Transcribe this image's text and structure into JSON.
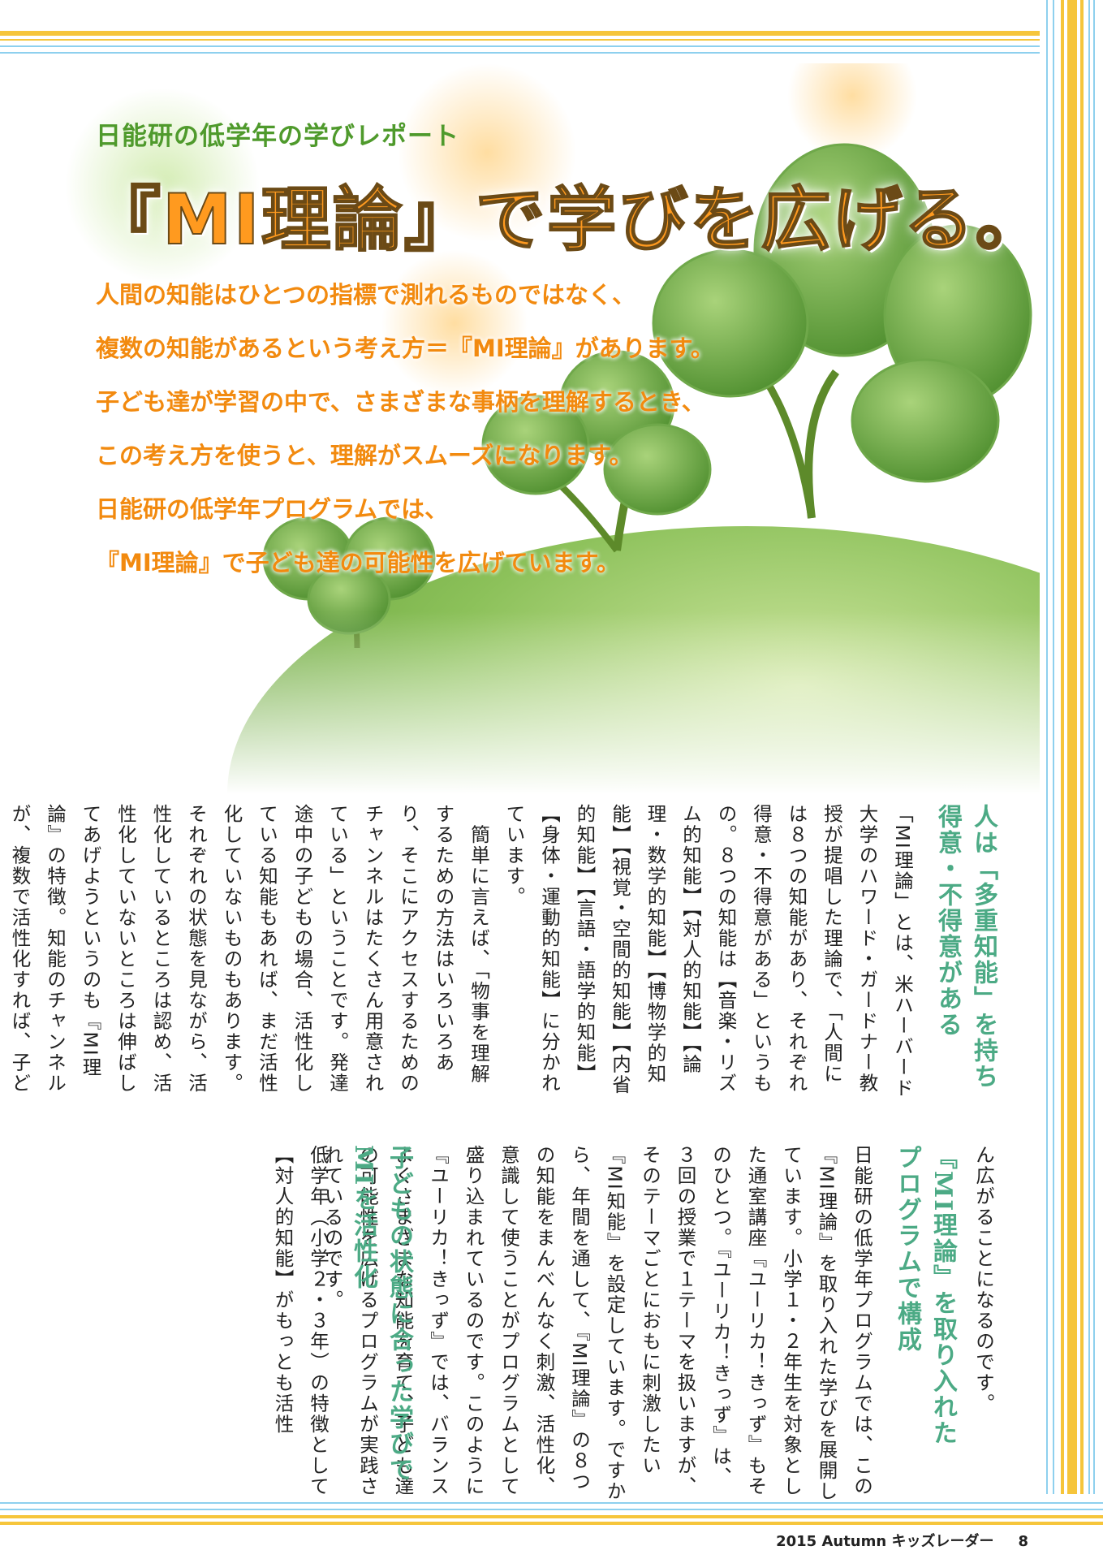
{
  "header": {
    "kicker": "日能研の低学年の学びレポート",
    "title": "『MI理論』で学びを広げる。"
  },
  "intro_lines": [
    "人間の知能はひとつの指標で測れるものではなく、",
    "複数の知能があるという考え方＝『MI理論』があります。",
    "子ども達が学習の中で、さまざまな事柄を理解するとき、",
    "この考え方を使うと、理解がスムーズになります。",
    "日能研の低学年プログラムでは、",
    "『MI理論』で子ども達の可能性を広げています。"
  ],
  "sections": {
    "s1_heading": "人は「多重知能」を持ち\n得意・不得意がある",
    "s1_body": "「MI理論」とは、米ハーバード大学のハワード・ガードナー教授が提唱した理論で、「人間には８つの知能があり、それぞれ得意・不得意がある」というもの。８つの知能は【音楽・リズム的知能】【対人的知能】【論理・数学的知能】【博物学的知能】【視覚・空間的知能】【内省的知能】【言語・語学的知能】【身体・運動的知能】に分かれています。\n　簡単に言えば、「物事を理解するための方法はいろいろあり、そこにアクセスするためのチャンネルはたくさん用意されている」ということです。発達途中の子どもの場合、活性化している知能もあれば、まだ活性化していないものもあります。それぞれの状態を見ながら、活性化しているところは認め、活性化していないところは伸ばしてあげようというのも『MI理論』の特徴。知能のチャンネルが、複数で活性化すれば、子どもの学びの可能性はどんど",
    "s1_tail": "ん広がることになるのです。",
    "s2_heading": "『MI理論』を取り入れた\nプログラムで構成",
    "s2_body": "日能研の低学年プログラムでは、この『MI理論』を取り入れた学びを展開しています。小学１・２年生を対象とした通室講座『ユーリカ！きっず』もそのひとつ。『ユーリカ！きっず』は、３回の授業で１テーマを扱いますが、そのテーマごとにおもに刺激したい『MI知能』を設定しています。ですから、年間を通して、『MI理論』の８つの知能をまんべんなく刺激、活性化、意識して使うことがプログラムとして盛り込まれているのです。このように『ユーリカ！きっず』では、バランスよくさまざまな知能を育て、子ども達の可能性を広げるプログラムが実践されているのです。",
    "s3_heading": "子どもの状態に合った学びで\nMIを活性化",
    "s3_body": "低学年（小学２・３年）の特徴として【対人的知能】がもっとも活性"
  },
  "footer": {
    "issue": "2015 Autumn キッズレーダー",
    "page": "8"
  },
  "colors": {
    "title_orange": "#ff9a1f",
    "kicker_green": "#4f9a2c",
    "heading_teal": "#4caa85",
    "border_yellow": "#f6c53b",
    "border_blue": "#8ed0ee"
  }
}
